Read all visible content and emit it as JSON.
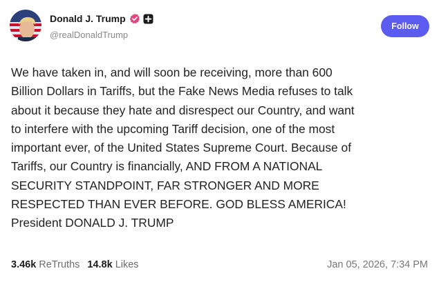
{
  "author": {
    "name": "Donald J. Trump",
    "handle": "@realDonaldTrump",
    "verified_color": "#e0467f"
  },
  "follow_button": {
    "label": "Follow",
    "color": "#5b5bf0"
  },
  "post": {
    "lines": [
      "We have taken in, and will soon be receiving, more than 600",
      "Billion Dollars in Tariffs, but the Fake News Media refuses to talk",
      "about it because they hate and disrespect our Country, and want",
      "to interfere with the upcoming Tariff decision, one of the most",
      "important ever, of the United States Supreme Court. Because of",
      "Tariffs, our Country is financially, AND FROM A NATIONAL",
      "SECURITY STANDPOINT, FAR STRONGER AND MORE",
      "RESPECTED THAN EVER BEFORE. GOD BLESS AMERICA!",
      "President DONALD J. TRUMP"
    ]
  },
  "stats": {
    "retruths_count": "3.46k",
    "retruths_label": "ReTruths",
    "likes_count": "14.8k",
    "likes_label": "Likes"
  },
  "timestamp": "Jan 05, 2026, 7:34 PM"
}
